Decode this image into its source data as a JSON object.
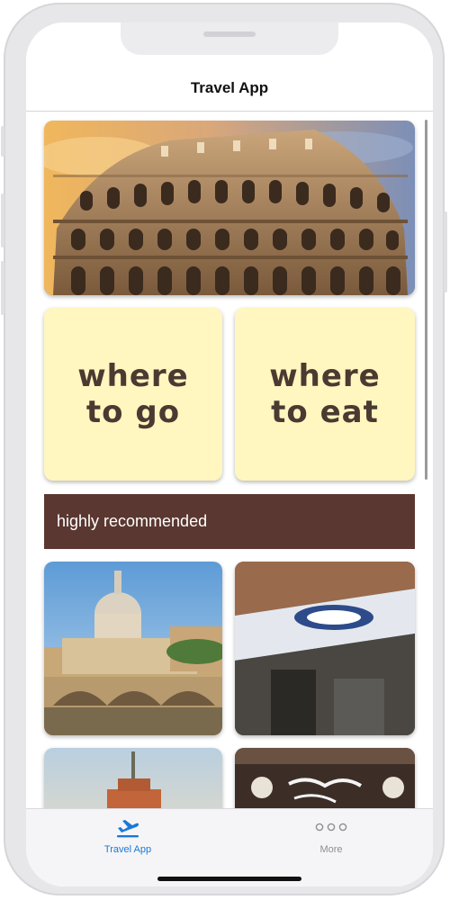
{
  "app": {
    "title": "Travel App"
  },
  "tiles": {
    "where_to_go": {
      "line1": "where",
      "line2": "to go"
    },
    "where_to_eat": {
      "line1": "where",
      "line2": "to eat"
    }
  },
  "banner": {
    "label": "highly recommended"
  },
  "tabbar": {
    "items": [
      {
        "label": "Travel App",
        "icon": "airplane-takeoff-icon",
        "active": true
      },
      {
        "label": "More",
        "icon": "more-dots-icon",
        "active": false
      }
    ]
  },
  "colors": {
    "accent": "#1a79d6",
    "banner": "#5a3730",
    "tile": "#fff6c0",
    "tile_text": "#4a3a31",
    "inactive": "#8e8e93"
  }
}
